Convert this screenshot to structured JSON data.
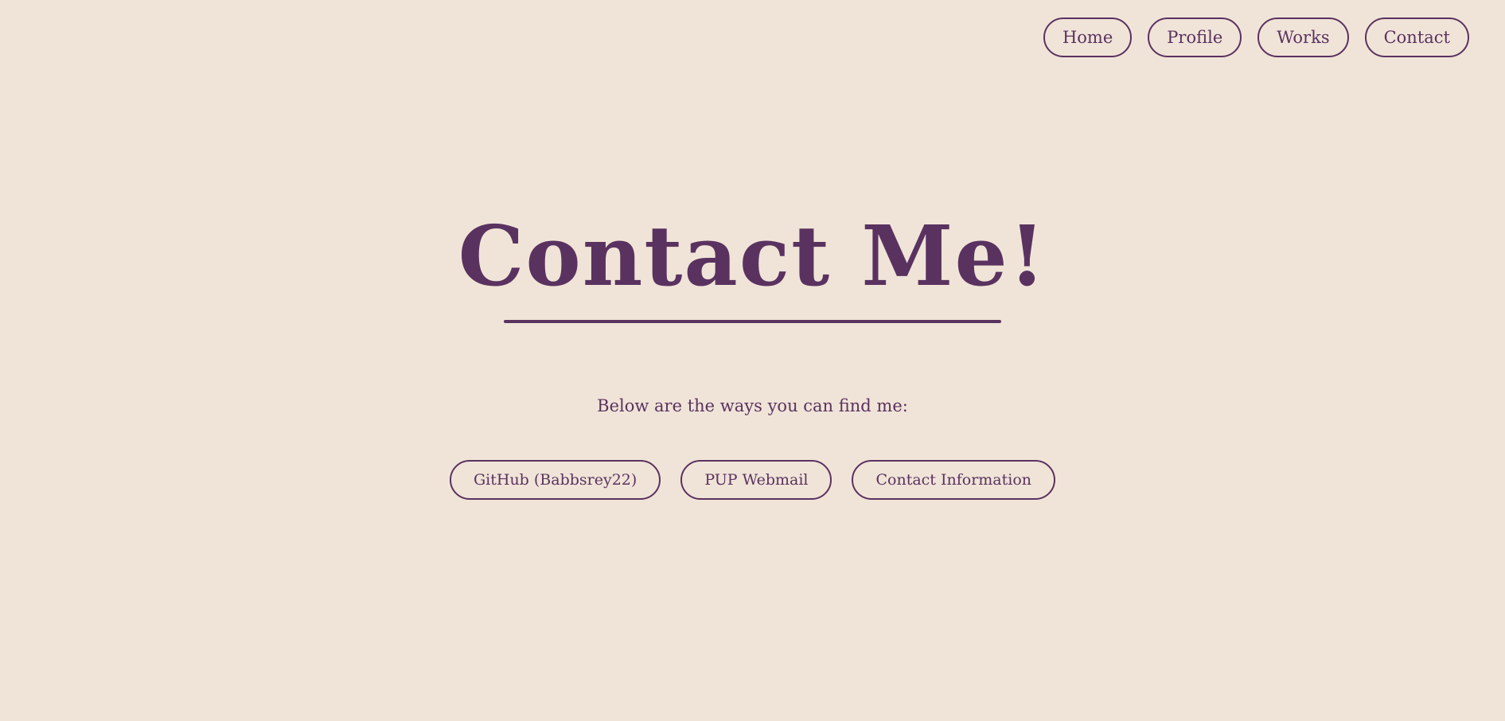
{
  "nav": {
    "items": [
      {
        "label": "Home"
      },
      {
        "label": "Profile"
      },
      {
        "label": "Works"
      },
      {
        "label": "Contact"
      }
    ]
  },
  "hero": {
    "title": "Contact Me!",
    "subtitle": "Below are the ways you can find me:"
  },
  "links": [
    {
      "label": "GitHub (Babbsrey22)"
    },
    {
      "label": "PUP Webmail"
    },
    {
      "label": "Contact Information"
    }
  ],
  "colors": {
    "background": "#f0e4d8",
    "accent": "#5a3260"
  }
}
